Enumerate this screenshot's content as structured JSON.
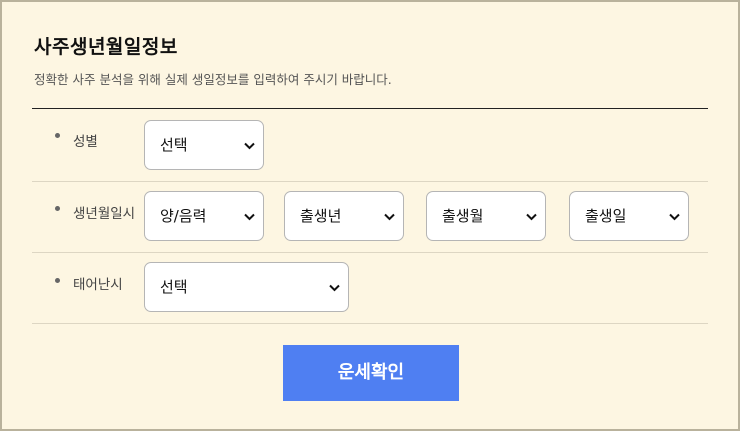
{
  "header": {
    "title": "사주생년월일정보",
    "subtitle": "정확한 사주 분석을 위해 실제 생일정보를 입력하여 주시기 바랍니다."
  },
  "form": {
    "gender": {
      "label": "성별",
      "select": "선택"
    },
    "birth": {
      "label": "생년월일시",
      "calendar_type": "양/음력",
      "year": "출생년",
      "month": "출생월",
      "day": "출생일"
    },
    "birth_time": {
      "label": "태어난시",
      "select": "선택"
    },
    "submit_label": "운세확인"
  },
  "colors": {
    "background": "#fdf6e2",
    "button": "#4f7ff2",
    "border": "#b9b29c"
  },
  "icons": {
    "dropdown": "chevron-down-icon",
    "bullet": "bullet-dot-icon"
  }
}
